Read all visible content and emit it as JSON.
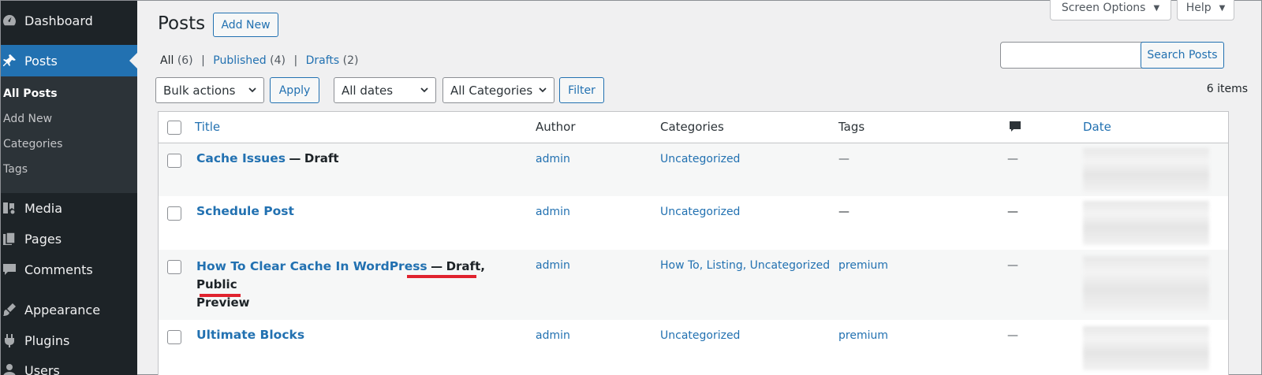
{
  "sidebar": {
    "items": [
      {
        "label": "Dashboard",
        "icon": "dashboard-icon"
      },
      {
        "label": "Posts",
        "icon": "pushpin-icon"
      },
      {
        "label": "Media",
        "icon": "media-icon"
      },
      {
        "label": "Pages",
        "icon": "pages-icon"
      },
      {
        "label": "Comments",
        "icon": "comments-icon"
      },
      {
        "label": "Appearance",
        "icon": "appearance-icon"
      },
      {
        "label": "Plugins",
        "icon": "plugins-icon"
      },
      {
        "label": "Users",
        "icon": "users-icon"
      }
    ],
    "submenu": [
      "All Posts",
      "Add New",
      "Categories",
      "Tags"
    ]
  },
  "header": {
    "title": "Posts",
    "add_new": "Add New",
    "screen_options": "Screen Options",
    "help": "Help"
  },
  "filters": {
    "all": "All",
    "all_count": "(6)",
    "published": "Published",
    "published_count": "(4)",
    "drafts": "Drafts",
    "drafts_count": "(2)",
    "sep": "|",
    "bulk_actions": "Bulk actions",
    "apply": "Apply",
    "all_dates": "All dates",
    "all_categories": "All Categories",
    "filter": "Filter",
    "search_button": "Search Posts",
    "items_count": "6 items"
  },
  "table": {
    "headers": {
      "title": "Title",
      "author": "Author",
      "categories": "Categories",
      "tags": "Tags",
      "date": "Date"
    },
    "rows": [
      {
        "title": "Cache Issues",
        "separator": "—",
        "state": "Draft",
        "state2": "",
        "author": "admin",
        "categories": "Uncategorized",
        "tags": "—",
        "comments": "—"
      },
      {
        "title": "Schedule Post",
        "separator": "",
        "state": "",
        "state2": "",
        "author": "admin",
        "categories": "Uncategorized",
        "tags": "—",
        "comments": "—"
      },
      {
        "title": "How To Clear Cache In WordPress",
        "separator": "—",
        "state": "Draft, Public",
        "state2": "Preview",
        "author": "admin",
        "categories": "How To, Listing, Uncategorized",
        "tags": "premium",
        "comments": "—"
      },
      {
        "title": "Ultimate Blocks",
        "separator": "",
        "state": "",
        "state2": "",
        "author": "admin",
        "categories": "Uncategorized",
        "tags": "premium",
        "comments": "—"
      }
    ]
  },
  "colors": {
    "accent": "#2271b1",
    "sidebar_bg": "#1d2327",
    "highlight": "#e0232e"
  }
}
